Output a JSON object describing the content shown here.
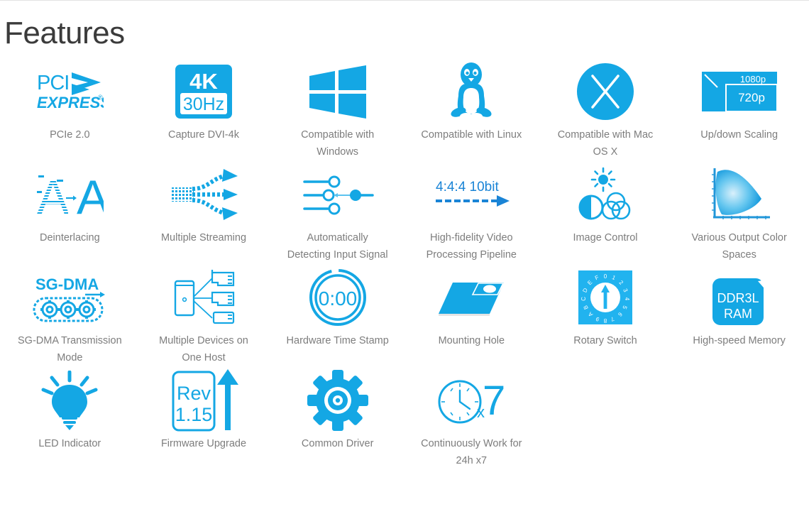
{
  "page": {
    "title": "Features",
    "accent_color": "#14a7e4",
    "accent_dark": "#0d8ecb",
    "label_color": "#7d7d7d",
    "title_color": "#3b3b3b",
    "rule_color": "#e3e3e3",
    "background": "#ffffff"
  },
  "features": [
    {
      "id": "pcie-2-0",
      "label": "PCIe 2.0",
      "icon": "pci-express-logo-icon",
      "text": {
        "line1": "PCI",
        "line2": "EXPRESS"
      }
    },
    {
      "id": "capture-dvi-4k",
      "label": "Capture DVI-4k",
      "icon": "4k-30hz-badge-icon",
      "text": {
        "line1": "4K",
        "line2": "30Hz"
      }
    },
    {
      "id": "compatible-windows",
      "label": "Compatible with Windows",
      "icon": "windows-logo-icon"
    },
    {
      "id": "compatible-linux",
      "label": "Compatible with Linux",
      "icon": "linux-penguin-icon"
    },
    {
      "id": "compatible-macosx",
      "label": "Compatible with Mac OS X",
      "icon": "mac-os-x-circle-icon"
    },
    {
      "id": "up-down-scaling",
      "label": "Up/down Scaling",
      "icon": "up-down-scaling-icon",
      "text": {
        "line1": "1080p",
        "line2": "720p"
      }
    },
    {
      "id": "deinterlacing",
      "label": "Deinterlacing",
      "icon": "deinterlacing-icon",
      "text": {
        "line1": "A",
        "line2": "A"
      }
    },
    {
      "id": "multiple-streaming",
      "label": "Multiple Streaming",
      "icon": "multiple-streaming-icon"
    },
    {
      "id": "auto-detect-signal",
      "label": "Automatically Detecting Input Signal",
      "icon": "signal-sliders-icon"
    },
    {
      "id": "video-pipeline",
      "label": "High-fidelity Video Processing Pipeline",
      "icon": "color-depth-arrow-icon",
      "text": {
        "line1": "4:4:4 10bit"
      }
    },
    {
      "id": "image-control",
      "label": "Image Control",
      "icon": "image-control-icon"
    },
    {
      "id": "output-color-spaces",
      "label": "Various Output Color Spaces",
      "icon": "chromaticity-diagram-icon"
    },
    {
      "id": "sg-dma-mode",
      "label": "SG-DMA Transmission Mode",
      "icon": "sg-dma-gears-icon",
      "text": {
        "line1": "SG-DMA"
      }
    },
    {
      "id": "multi-device-host",
      "label": "Multiple Devices on One Host",
      "icon": "multi-device-host-icon"
    },
    {
      "id": "hardware-time-stamp",
      "label": "Hardware Time Stamp",
      "icon": "timer-icon",
      "text": {
        "line1": "0:00"
      }
    },
    {
      "id": "mounting-hole",
      "label": "Mounting Hole",
      "icon": "mounting-hole-icon"
    },
    {
      "id": "rotary-switch",
      "label": "Rotary Switch",
      "icon": "rotary-switch-icon",
      "dial_digits": [
        "0",
        "1",
        "2",
        "3",
        "4",
        "5",
        "6",
        "7",
        "8",
        "9",
        "A",
        "B",
        "C",
        "D",
        "E",
        "F"
      ]
    },
    {
      "id": "high-speed-memory",
      "label": "High-speed Memory",
      "icon": "ddr3l-ram-icon",
      "text": {
        "line1": "DDR3L",
        "line2": "RAM"
      }
    },
    {
      "id": "led-indicator",
      "label": "LED Indicator",
      "icon": "light-bulb-icon"
    },
    {
      "id": "firmware-upgrade",
      "label": "Firmware Upgrade",
      "icon": "firmware-upgrade-icon",
      "text": {
        "line1": "Rev",
        "line2": "1.15"
      }
    },
    {
      "id": "common-driver",
      "label": "Common Driver",
      "icon": "gear-icon"
    },
    {
      "id": "continuous-work",
      "label": "Continuously Work for 24h x7",
      "icon": "clock-x7-icon",
      "text": {
        "line1": "x",
        "line2": "7"
      }
    }
  ]
}
